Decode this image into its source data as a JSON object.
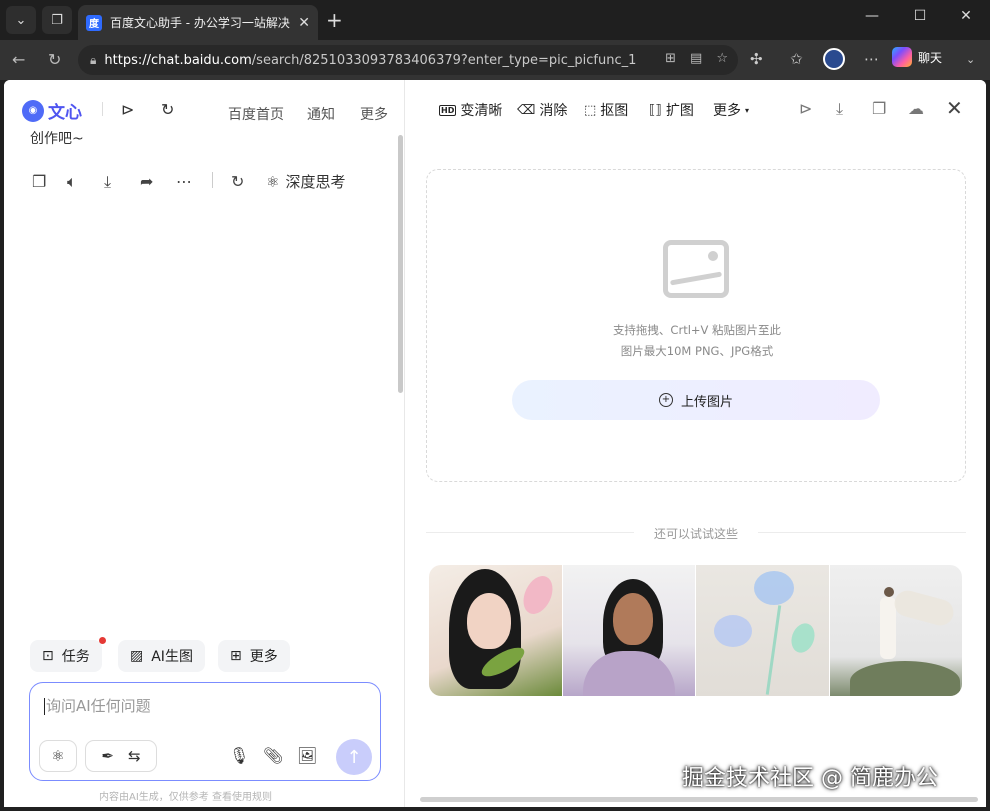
{
  "browser": {
    "tab_title": "百度文心助手 - 办公学习一站解决",
    "url_host": "https://chat.baidu.com",
    "url_path": "/search/8251033093783406379?enter_type=pic_picfunc_1",
    "chat_button": "聊天"
  },
  "header": {
    "logo": "文心",
    "links": [
      "百度首页",
      "通知",
      "更多"
    ]
  },
  "conversation": {
    "message_tail": "创作吧~",
    "deep_think": "深度思考"
  },
  "quick_actions": [
    {
      "label": "任务",
      "icon": "task-icon"
    },
    {
      "label": "AI生图",
      "icon": "image-gen-icon"
    },
    {
      "label": "更多",
      "icon": "grid-icon"
    }
  ],
  "input": {
    "placeholder": "询问AI任何问题",
    "disclaimer": "内容由AI生成，仅供参考   查看使用规则"
  },
  "image_tools": {
    "toolbar": [
      "变清晰",
      "消除",
      "抠图",
      "扩图",
      "更多"
    ],
    "upload_hint_1": "支持拖拽、Crtl+V 粘贴图片至此",
    "upload_hint_2": "图片最大10M PNG、JPG格式",
    "upload_button": "上传图片",
    "try_label": "还可以试试这些"
  },
  "watermark": "掘金技术社区 @ 简鹿办公"
}
